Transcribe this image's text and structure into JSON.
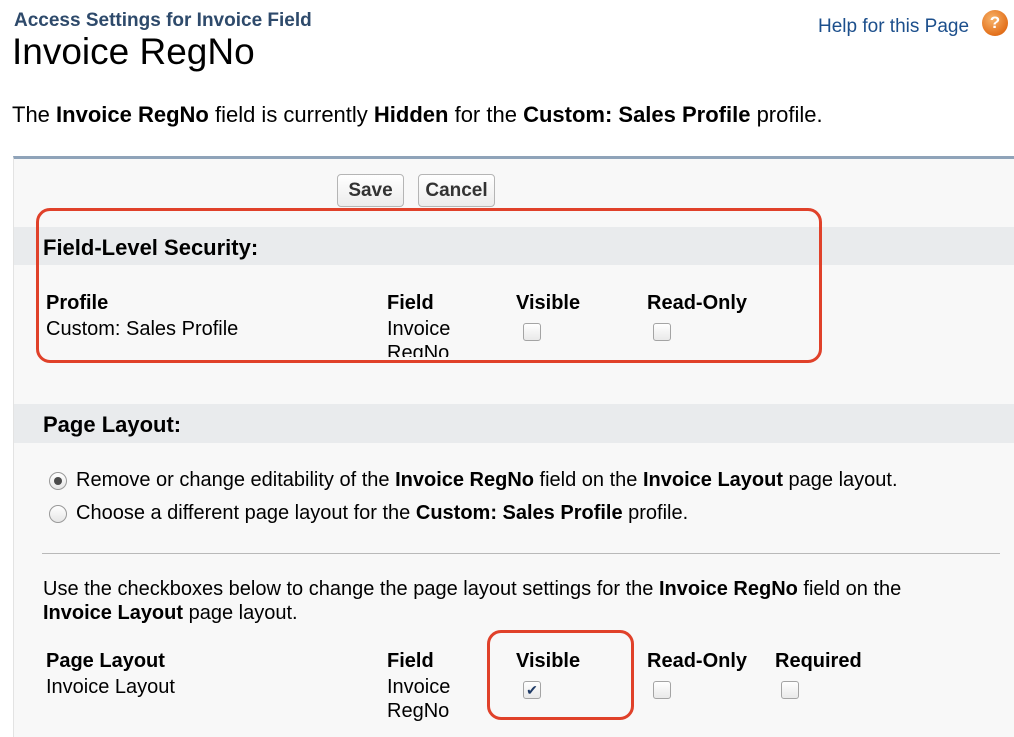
{
  "header": {
    "subtitle": "Access Settings for Invoice Field",
    "title": "Invoice RegNo",
    "help_link": "Help for this Page",
    "help_icon": "question-circle-icon"
  },
  "intro": {
    "p1": "The ",
    "field": "Invoice RegNo",
    "p2": " field is currently ",
    "status": "Hidden",
    "p3": " for the ",
    "profile": "Custom: Sales Profile",
    "p4": " profile."
  },
  "toolbar": {
    "save_label": "Save",
    "cancel_label": "Cancel"
  },
  "fls": {
    "title": "Field-Level Security:",
    "headers": {
      "profile": "Profile",
      "field": "Field",
      "visible": "Visible",
      "readonly": "Read-Only"
    },
    "row": {
      "profile": "Custom: Sales Profile",
      "field_line1": "Invoice",
      "field_line2": "RegNo",
      "visible_checked": false,
      "readonly_checked": false
    }
  },
  "layout": {
    "title": "Page Layout:",
    "option1": {
      "t1": "Remove or change editability of the ",
      "b1": "Invoice RegNo",
      "t2": " field on the ",
      "b2": "Invoice Layout",
      "t3": " page layout.",
      "selected": true
    },
    "option2": {
      "t1": "Choose a different page layout for the ",
      "b1": "Custom: Sales Profile",
      "t2": " profile.",
      "selected": false
    },
    "instructions": {
      "t1": "Use the checkboxes below to change the page layout settings for the ",
      "b1": "Invoice RegNo",
      "t2": " field on the",
      "b2": "Invoice Layout",
      "t3": " page layout."
    },
    "headers": {
      "page_layout": "Page Layout",
      "field": "Field",
      "visible": "Visible",
      "readonly": "Read-Only",
      "required": "Required"
    },
    "row": {
      "page_layout": "Invoice Layout",
      "field_line1": "Invoice",
      "field_line2": "RegNo",
      "visible_checked": true,
      "readonly_checked": false,
      "required_checked": false
    }
  },
  "colors": {
    "highlight": "#e0412a",
    "subtitle": "#2e4a6b",
    "link": "#1c4f8c",
    "section_band": "#e9ebed"
  }
}
